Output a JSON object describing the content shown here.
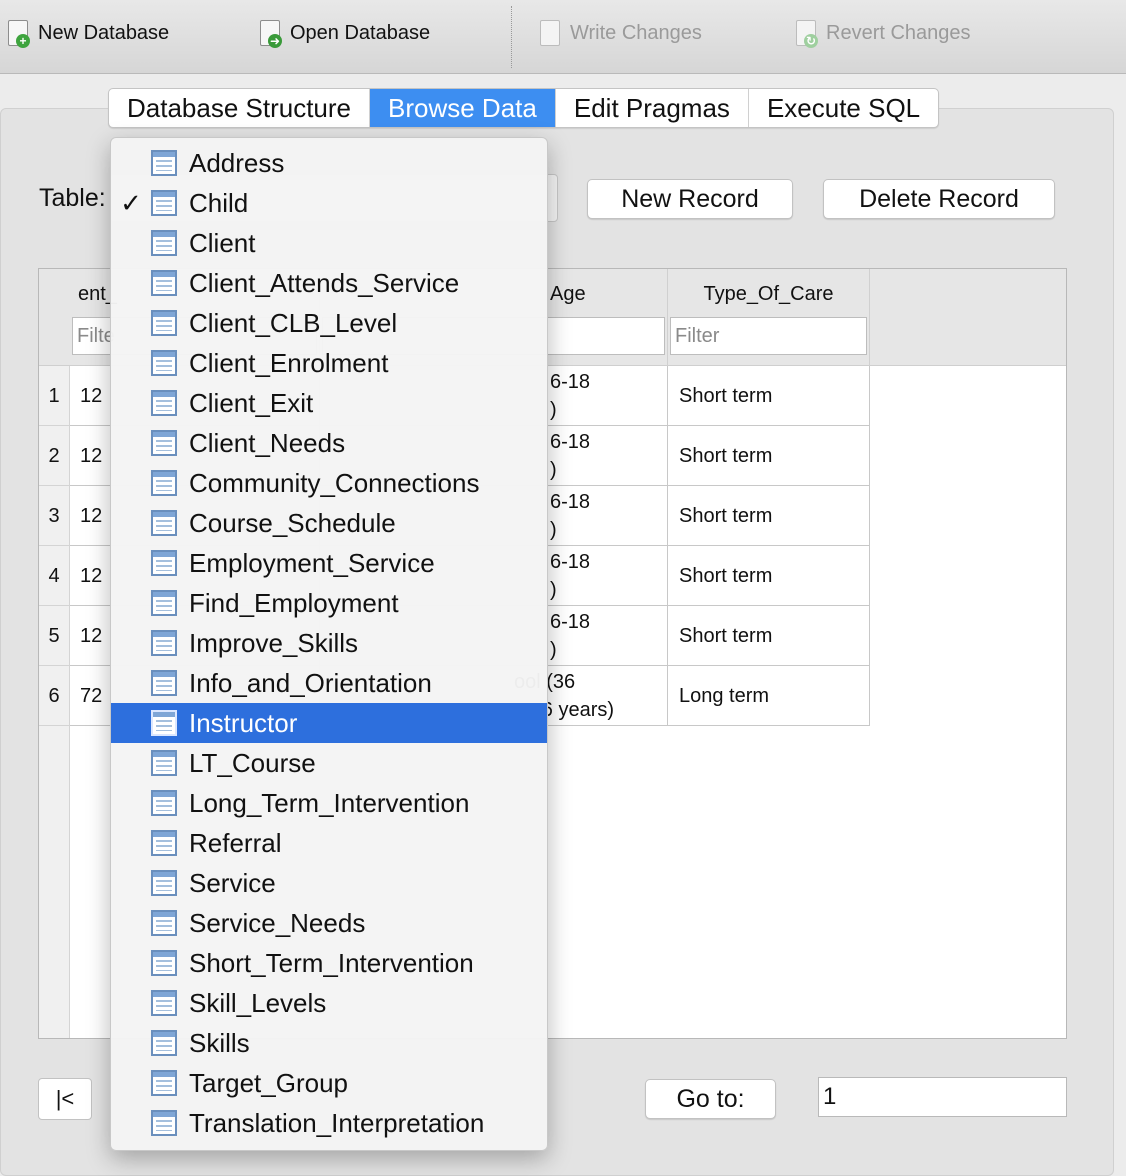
{
  "toolbar": {
    "new_database": "New Database",
    "open_database": "Open Database",
    "write_changes": "Write Changes",
    "revert_changes": "Revert Changes"
  },
  "tabs": [
    {
      "label": "Database Structure",
      "active": false
    },
    {
      "label": "Browse Data",
      "active": true
    },
    {
      "label": "Edit Pragmas",
      "active": false
    },
    {
      "label": "Execute SQL",
      "active": false
    }
  ],
  "table_label": "Table:",
  "buttons": {
    "new_record": "New Record",
    "delete_record": "Delete Record"
  },
  "grid": {
    "col1_header_partial": "ent_",
    "col3_header": "Age",
    "col4_header": "Type_Of_Care",
    "filter_placeholder": "Filter",
    "filter_partial": "Filte",
    "rows": [
      {
        "num": "1",
        "id_partial": "12",
        "age": "6-18",
        "age2": ")",
        "care": "Short term"
      },
      {
        "num": "2",
        "id_partial": "12",
        "age": "6-18",
        "age2": ")",
        "care": "Short term"
      },
      {
        "num": "3",
        "id_partial": "12",
        "age": "6-18",
        "age2": ")",
        "care": "Short term"
      },
      {
        "num": "4",
        "id_partial": "12",
        "age": "6-18",
        "age2": ")",
        "care": "Short term"
      },
      {
        "num": "5",
        "id_partial": "12",
        "age": "6-18",
        "age2": ")",
        "care": "Short term"
      },
      {
        "num": "6",
        "id_partial": "72",
        "age": "ool (36",
        "age2": "s - 6 years)",
        "care": "Long term"
      }
    ]
  },
  "nav": {
    "first": "|<",
    "goto_label": "Go to:",
    "goto_value": "1"
  },
  "menu": {
    "items": [
      {
        "label": "Address",
        "checked": false,
        "highlight": false
      },
      {
        "label": "Child",
        "checked": true,
        "highlight": false
      },
      {
        "label": "Client",
        "checked": false,
        "highlight": false
      },
      {
        "label": "Client_Attends_Service",
        "checked": false,
        "highlight": false
      },
      {
        "label": "Client_CLB_Level",
        "checked": false,
        "highlight": false
      },
      {
        "label": "Client_Enrolment",
        "checked": false,
        "highlight": false
      },
      {
        "label": "Client_Exit",
        "checked": false,
        "highlight": false
      },
      {
        "label": "Client_Needs",
        "checked": false,
        "highlight": false
      },
      {
        "label": "Community_Connections",
        "checked": false,
        "highlight": false
      },
      {
        "label": "Course_Schedule",
        "checked": false,
        "highlight": false
      },
      {
        "label": "Employment_Service",
        "checked": false,
        "highlight": false
      },
      {
        "label": "Find_Employment",
        "checked": false,
        "highlight": false
      },
      {
        "label": "Improve_Skills",
        "checked": false,
        "highlight": false
      },
      {
        "label": "Info_and_Orientation",
        "checked": false,
        "highlight": false
      },
      {
        "label": "Instructor",
        "checked": false,
        "highlight": true
      },
      {
        "label": "LT_Course",
        "checked": false,
        "highlight": false
      },
      {
        "label": "Long_Term_Intervention",
        "checked": false,
        "highlight": false
      },
      {
        "label": "Referral",
        "checked": false,
        "highlight": false
      },
      {
        "label": "Service",
        "checked": false,
        "highlight": false
      },
      {
        "label": "Service_Needs",
        "checked": false,
        "highlight": false
      },
      {
        "label": "Short_Term_Intervention",
        "checked": false,
        "highlight": false
      },
      {
        "label": "Skill_Levels",
        "checked": false,
        "highlight": false
      },
      {
        "label": "Skills",
        "checked": false,
        "highlight": false
      },
      {
        "label": "Target_Group",
        "checked": false,
        "highlight": false
      },
      {
        "label": "Translation_Interpretation",
        "checked": false,
        "highlight": false
      }
    ]
  }
}
